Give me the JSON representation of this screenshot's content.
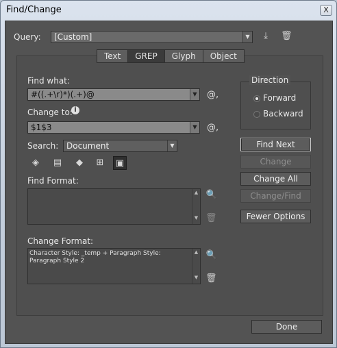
{
  "window": {
    "title": "Find/Change",
    "close_label": "X"
  },
  "query": {
    "label": "Query:",
    "value": "[Custom]"
  },
  "tabs": [
    {
      "label": "Text",
      "active": false
    },
    {
      "label": "GREP",
      "active": true
    },
    {
      "label": "Glyph",
      "active": false
    },
    {
      "label": "Object",
      "active": false
    }
  ],
  "find": {
    "label": "Find what:",
    "value": "#((.+\\r)*)(.+)@",
    "special_label": "@,"
  },
  "change": {
    "label": "Change to:",
    "info_icon": "info-icon",
    "value": "$1$3",
    "special_label": "@,"
  },
  "search": {
    "label": "Search:",
    "value": "Document"
  },
  "find_format": {
    "label": "Find Format:",
    "text": ""
  },
  "change_format": {
    "label": "Change Format:",
    "text": "Character Style: _temp + Paragraph Style: Paragraph Style 2"
  },
  "direction": {
    "title": "Direction",
    "options": [
      "Forward",
      "Backward"
    ],
    "selected": "Forward"
  },
  "buttons": {
    "find_next": "Find Next",
    "change": "Change",
    "change_all": "Change All",
    "change_find": "Change/Find",
    "fewer_options": "Fewer Options",
    "done": "Done"
  }
}
